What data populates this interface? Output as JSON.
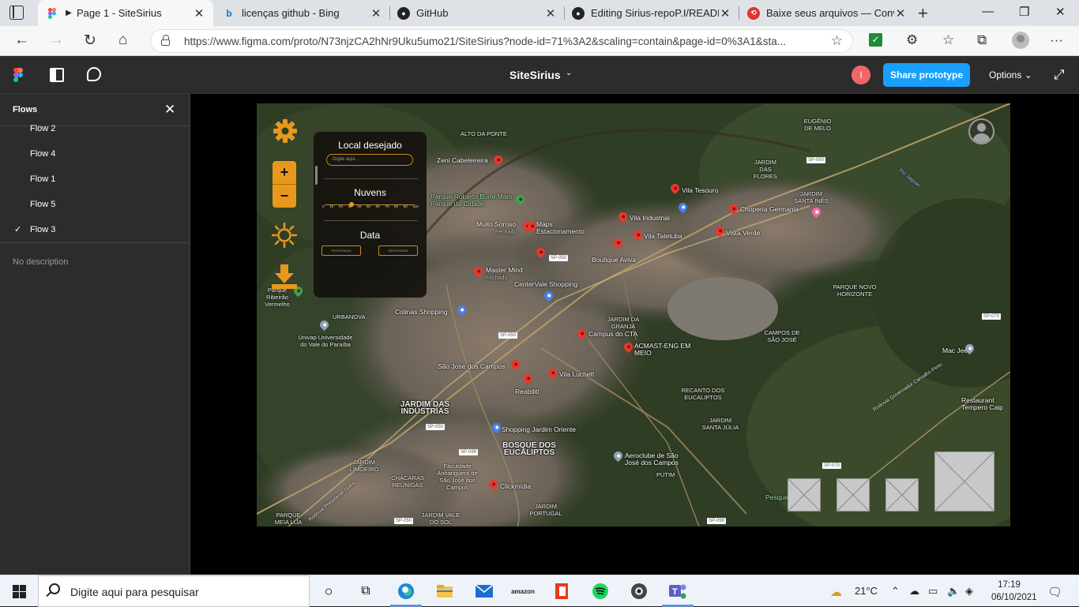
{
  "browser": {
    "tabs": [
      {
        "title": "Page 1 - SiteSirius",
        "active": true,
        "icon": "figma-icon"
      },
      {
        "title": "licenças github - Bing",
        "active": false,
        "icon": "bing-icon"
      },
      {
        "title": "GitHub",
        "active": false,
        "icon": "github-icon"
      },
      {
        "title": "Editing Sirius-repoP.I/READM",
        "active": false,
        "icon": "github-icon"
      },
      {
        "title": "Baixe seus arquivos — Conve",
        "active": false,
        "icon": "convert-icon"
      }
    ],
    "url": "https://www.figma.com/proto/N73njzCA2hNr9Uku5umo21/SiteSirius?node-id=71%3A2&scaling=contain&page-id=0%3A1&sta..."
  },
  "figma": {
    "file_title": "SiteSirius",
    "avatar_initial": "I",
    "share_label": "Share prototype",
    "options_label": "Options"
  },
  "flows_panel": {
    "title": "Flows",
    "items": [
      {
        "label": "Flow 2",
        "selected": false
      },
      {
        "label": "Flow 4",
        "selected": false
      },
      {
        "label": "Flow 1",
        "selected": false
      },
      {
        "label": "Flow 5",
        "selected": false
      },
      {
        "label": "Flow 3",
        "selected": true
      }
    ],
    "description": "No description"
  },
  "map_panel": {
    "location_heading": "Local desejado",
    "location_placeholder": "Digite aqui...",
    "clouds_heading": "Nuvens",
    "clouds_ticks": [
      "0",
      "10",
      "20",
      "30",
      "40",
      "50",
      "60",
      "70",
      "80",
      "90",
      "100"
    ],
    "clouds_value": 30,
    "date_heading": "Data",
    "date_from": "00/mm/aaaa",
    "date_to": "dd/mm/aaaa"
  },
  "map": {
    "labels": [
      "Zeni Cabeleireira",
      "ALTO DA PONTE",
      "Parque Roberto Burle Marx - Parque da Cidade",
      "Muito Sorriso",
      "Fechado",
      "Maps Estacionamento",
      "Master Mind",
      "Fechado",
      "CenterVale Shopping",
      "Colinas Shopping",
      "URBANOVA",
      "Univap Universidade do Vale do Paraíba",
      "Vila Tesouro",
      "Vila Industrial",
      "Vila Tatetuba",
      "Boutique Aviva",
      "Choperia Germania",
      "Vista Verde",
      "JARDIM DAS FLORES",
      "EUGÊNIO DE MELO",
      "JARDIM SANTA INÊS",
      "PARQUE NOVO HORIZONTE",
      "Campus do CTA",
      "JARDIM DA GRANJA",
      "ACMAST-ENG EM MEIO",
      "CAMPOS DE SÃO JOSÉ",
      "Mac Jee",
      "São José dos Campos",
      "Reabiliti",
      "Vila Luchett",
      "JARDIM DAS INDÚSTRIAS",
      "Shopping Jardim Oriente",
      "BOSQUE DOS EUCALIPTOS",
      "RECANTO DOS EUCALIPTOS",
      "JARDIM SANTA JÚLIA",
      "Aeroclube de São José dos Campos",
      "PUTIM",
      "JARDIM LIMOEIRO",
      "CHÁCARAS REUNIDAS",
      "Faculdade Anhanguera de São José dos Campos",
      "Clickmídia",
      "JARDIM PORTUGAL",
      "PARQUE MEIA LUA",
      "JARDIM VALE DO SOL",
      "Restaurant Tempero Caip",
      "Pesqueiro D",
      "Rodovia Governador Carvalho Pinto",
      "Rio Jaguari",
      "Rodovia Presidente Dutra",
      "Parque Ribeirão Vermelho"
    ],
    "routes": [
      "SP-050",
      "SP-050",
      "SP-050",
      "SP-050",
      "SP-070",
      "SP-099",
      "SP-070",
      "SP-099",
      "SP-050"
    ]
  },
  "taskbar": {
    "search_placeholder": "Digite aqui para pesquisar",
    "weather": "21°C",
    "time": "17:19",
    "date": "06/10/2021"
  },
  "colors": {
    "accent": "#e8981c",
    "figma_blue": "#18a0fb",
    "panel_bg": "#2c2c2c"
  }
}
